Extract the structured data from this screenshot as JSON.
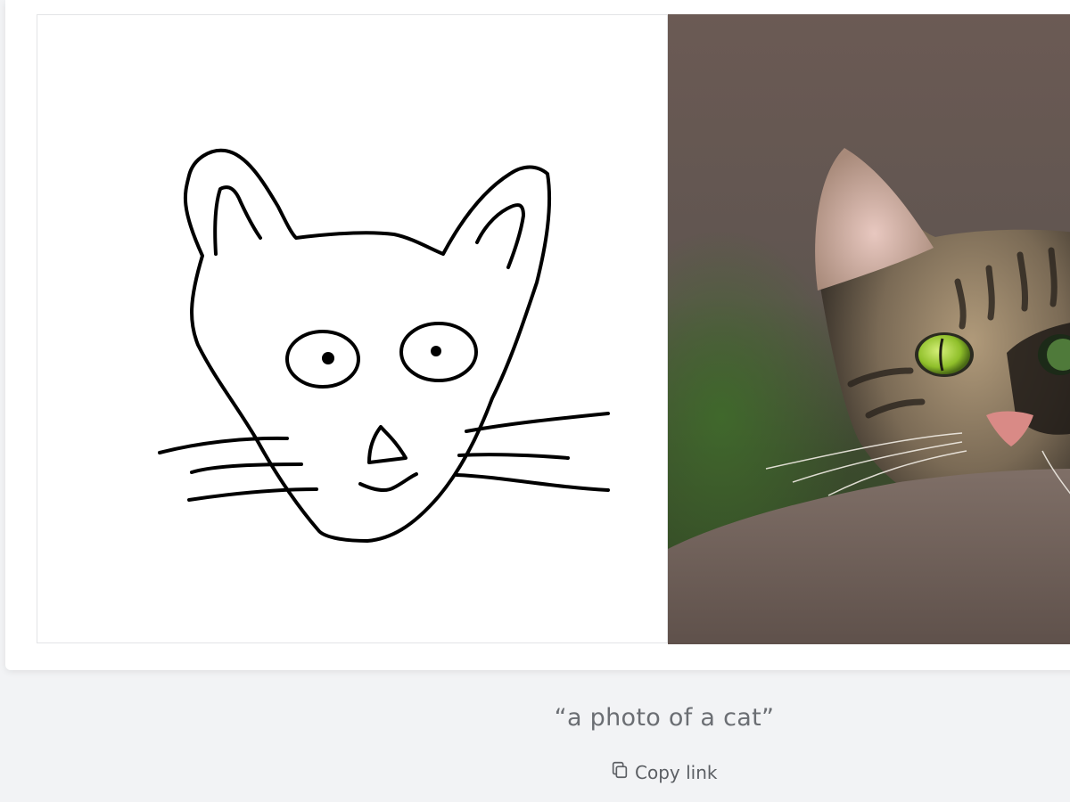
{
  "caption": {
    "text": "“a photo of a cat”"
  },
  "copy_link": {
    "label": "Copy link",
    "icon": "copy-icon"
  },
  "panels": {
    "sketch": {
      "subject": "hand-drawn-cat-sketch-icon"
    },
    "photo": {
      "subject": "cat-photo-icon"
    }
  },
  "colors": {
    "page_background": "#f2f3f5",
    "card_background": "#ffffff",
    "caption_text": "#6b6e73",
    "cat_eye": "#9acd32"
  }
}
